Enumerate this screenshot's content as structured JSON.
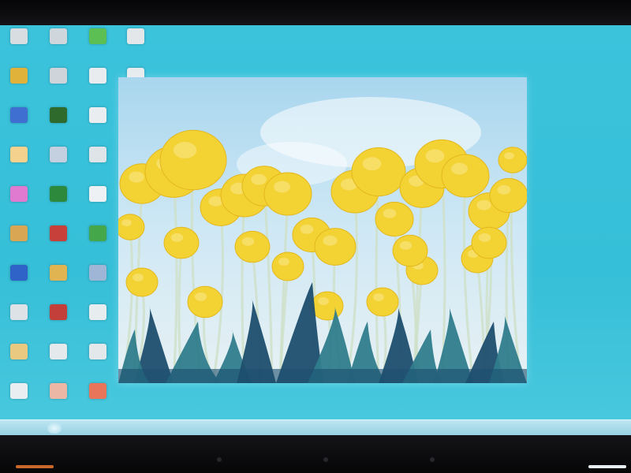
{
  "desktop": {
    "accent": "#36bfd8",
    "icons": [
      {
        "name": "desktop-icon",
        "color": "#d8dde2"
      },
      {
        "name": "desktop-icon",
        "color": "#cfd6dc"
      },
      {
        "name": "desktop-icon",
        "color": "#5bbf54"
      },
      {
        "name": "desktop-icon",
        "color": "#e3e7ea"
      },
      {
        "name": "desktop-icon",
        "color": "#e0b23a"
      },
      {
        "name": "desktop-icon",
        "color": "#cfd4da"
      },
      {
        "name": "desktop-icon",
        "color": "#e8ecef"
      },
      {
        "name": "desktop-icon",
        "color": "#e6ebee"
      },
      {
        "name": "desktop-icon",
        "color": "#3f6fd1"
      },
      {
        "name": "desktop-icon",
        "color": "#2d6a2b"
      },
      {
        "name": "desktop-icon",
        "color": "#e9edf0"
      },
      {
        "name": "desktop-icon",
        "color": "#f2e2a3"
      },
      {
        "name": "desktop-icon",
        "color": "#f4d28d"
      },
      {
        "name": "desktop-icon",
        "color": "#c4cfe0"
      },
      {
        "name": "desktop-icon",
        "color": "#dfe4e8"
      },
      {
        "name": "desktop-icon",
        "color": "#e7ebee"
      },
      {
        "name": "desktop-icon",
        "color": "#e07ad0"
      },
      {
        "name": "desktop-icon",
        "color": "#2d8a3c"
      },
      {
        "name": "desktop-icon",
        "color": "#eef1f3"
      },
      {
        "name": "desktop-icon",
        "color": "#d9a653"
      },
      {
        "name": "desktop-icon",
        "color": "#c8403a"
      },
      {
        "name": "desktop-icon",
        "color": "#44a84a"
      },
      {
        "name": "desktop-icon",
        "color": "#2f63c8"
      },
      {
        "name": "desktop-icon",
        "color": "#e0b450"
      },
      {
        "name": "desktop-icon",
        "color": "#9fb6d6"
      },
      {
        "name": "desktop-icon",
        "color": "#dde2e6"
      },
      {
        "name": "desktop-icon",
        "color": "#c33f3a"
      },
      {
        "name": "desktop-icon",
        "color": "#e7ecef"
      },
      {
        "name": "desktop-icon",
        "color": "#e9c880"
      },
      {
        "name": "desktop-icon",
        "color": "#e4e9ec"
      },
      {
        "name": "desktop-icon",
        "color": "#e3e8eb"
      },
      {
        "name": "desktop-icon",
        "color": "#e9eef1"
      },
      {
        "name": "desktop-icon",
        "color": "#ecb7a4"
      },
      {
        "name": "desktop-icon",
        "color": "#e8745a"
      },
      {
        "name": "desktop-icon",
        "color": "#e5eaee"
      }
    ]
  },
  "photo": {
    "sky": "#cfe8f5",
    "tulip": "#f3d233",
    "leaf": "#2f7c8c",
    "leaf_dark": "#1d4e6e"
  },
  "taskbar": {
    "tray_text": "",
    "background": "#a9d9e8"
  }
}
